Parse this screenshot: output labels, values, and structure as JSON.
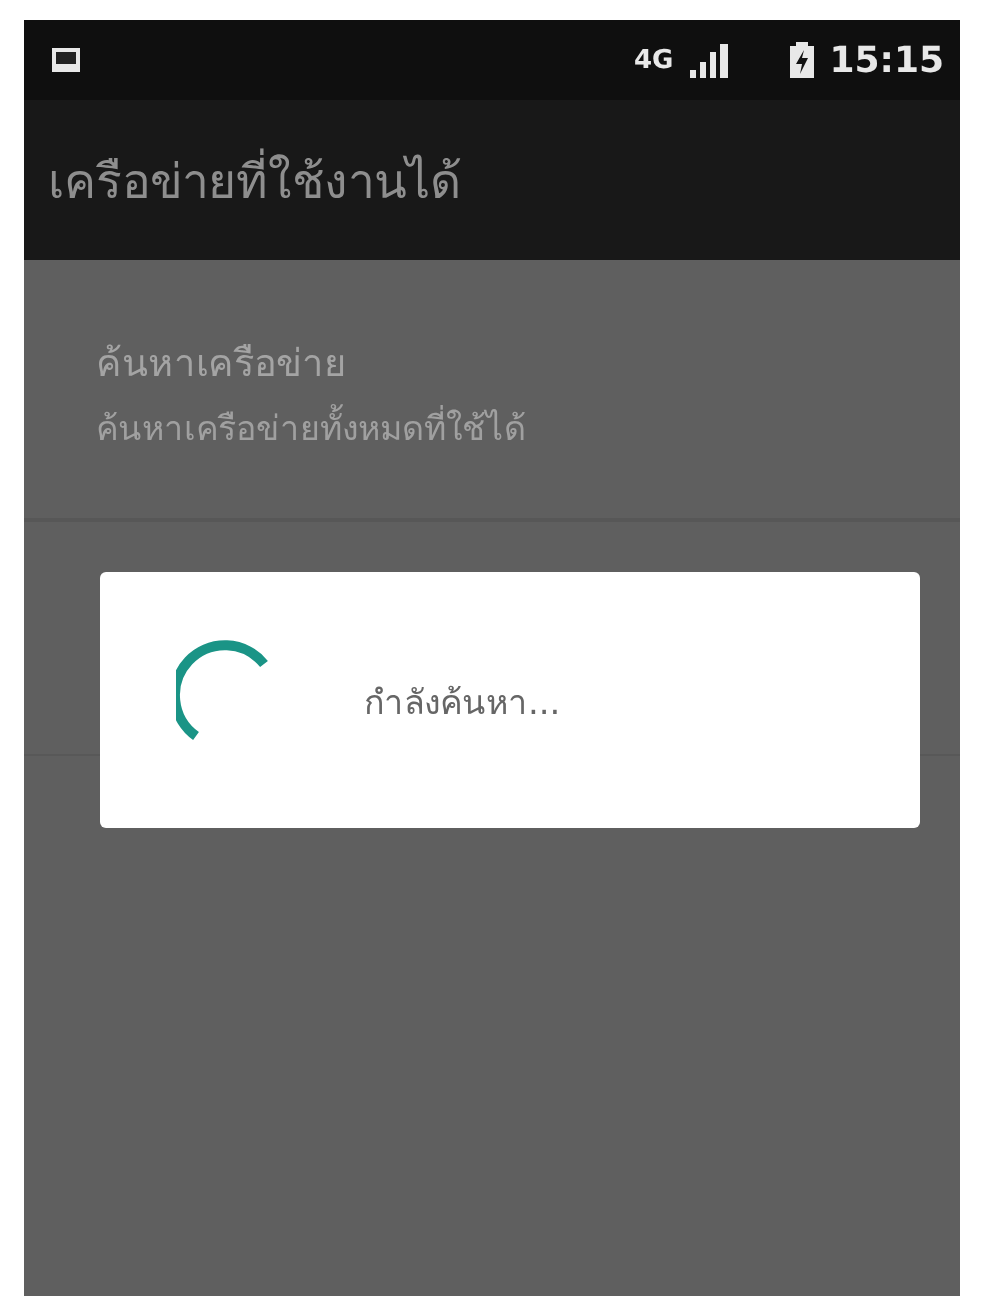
{
  "status_bar": {
    "network": "4G",
    "time": "15:15"
  },
  "app_bar": {
    "title": "เครือข่ายที่ใช้งานได้"
  },
  "list": [
    {
      "title": "ค้นหาเครือข่าย",
      "summary": "ค้นหาเครือข่ายทั้งหมดที่ใช้ได้"
    }
  ],
  "dialog": {
    "message": "กำลังค้นหา..."
  }
}
